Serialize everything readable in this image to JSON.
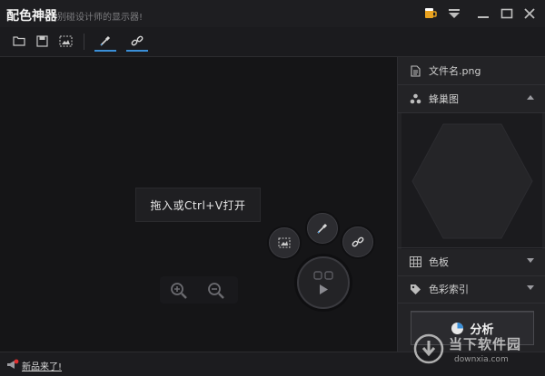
{
  "app": {
    "title": "配色神器",
    "subtitle": "别碰设计师的显示器!"
  },
  "canvas": {
    "drop_hint": "拖入或Ctrl+V打开"
  },
  "panel": {
    "file_name": "文件名.png",
    "honeycomb_label": "蜂巢图",
    "palette_label": "色板",
    "color_index_label": "色彩索引",
    "analyze_label": "分析"
  },
  "status": {
    "news_link": "新品来了!"
  },
  "watermark": {
    "name": "当下软件园",
    "url": "downxia.com"
  },
  "colors": {
    "accent": "#3a8fd8",
    "background": "#151517",
    "panel": "#232326"
  }
}
